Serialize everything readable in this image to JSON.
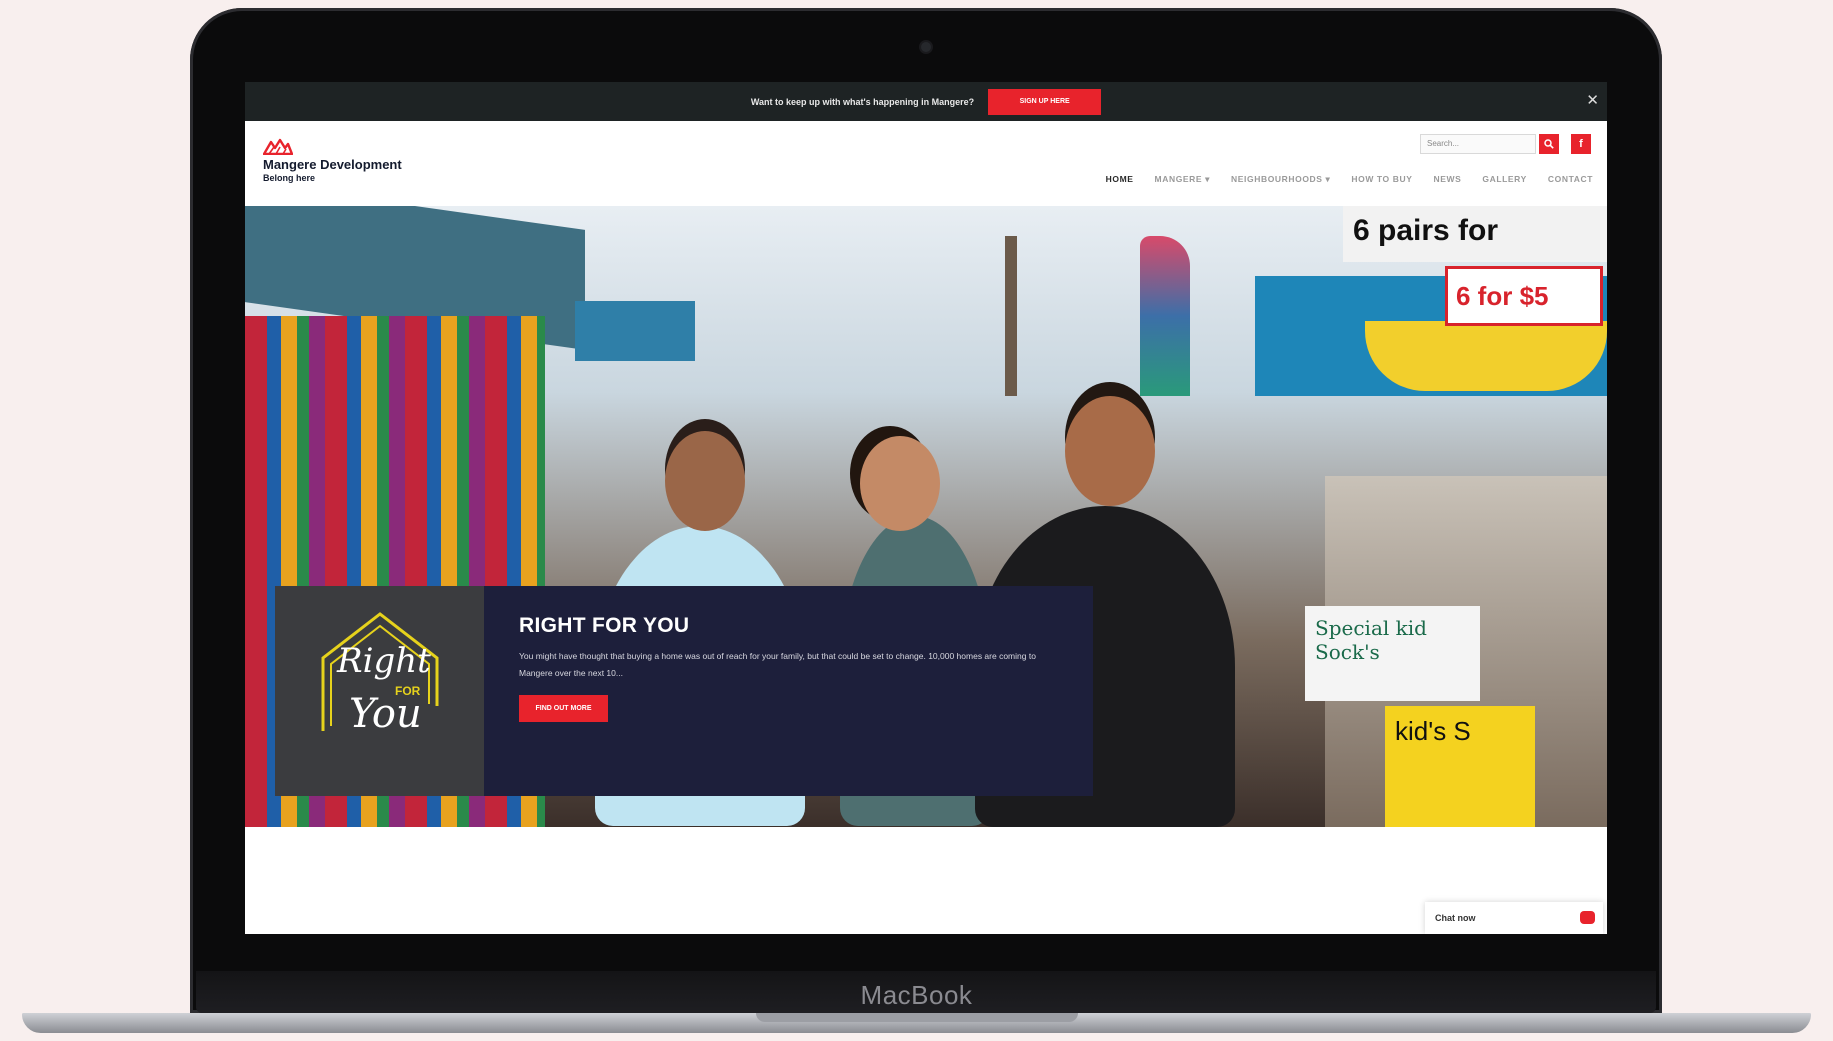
{
  "device": {
    "brand": "MacBook"
  },
  "announcement": {
    "text": "Want to keep up with what's happening in Mangere?",
    "button_label": "Sign up here",
    "close": "✕"
  },
  "site": {
    "name": "Mangere Development",
    "tagline": "Belong here"
  },
  "search": {
    "placeholder": "Search..."
  },
  "social": {
    "facebook": "f"
  },
  "nav": {
    "items": [
      {
        "label": "HOME",
        "active": true
      },
      {
        "label": "MANGERE ▾"
      },
      {
        "label": "NEIGHBOURHOODS ▾"
      },
      {
        "label": "HOW TO BUY"
      },
      {
        "label": "NEWS"
      },
      {
        "label": "GALLERY"
      },
      {
        "label": "CONTACT"
      }
    ]
  },
  "hero": {
    "signs": [
      "6 pairs for",
      "6 for $5",
      "Special kid Sock's",
      "kid's S",
      "6 pairs for"
    ]
  },
  "card": {
    "logo_words": [
      "Right",
      "FOR",
      "You"
    ],
    "title": "RIGHT FOR YOU",
    "text": "You might have thought that buying a home was out of reach for your family, but that could be set to change. 10,000 homes are coming to Mangere over the next 10...",
    "button_label": "Find out more"
  },
  "chat": {
    "label": "Chat now"
  },
  "colors": {
    "accent": "#e8232c",
    "navy": "#1d1f3b",
    "dark_bar": "#1e2324",
    "logo_yellow": "#e6d21c"
  }
}
